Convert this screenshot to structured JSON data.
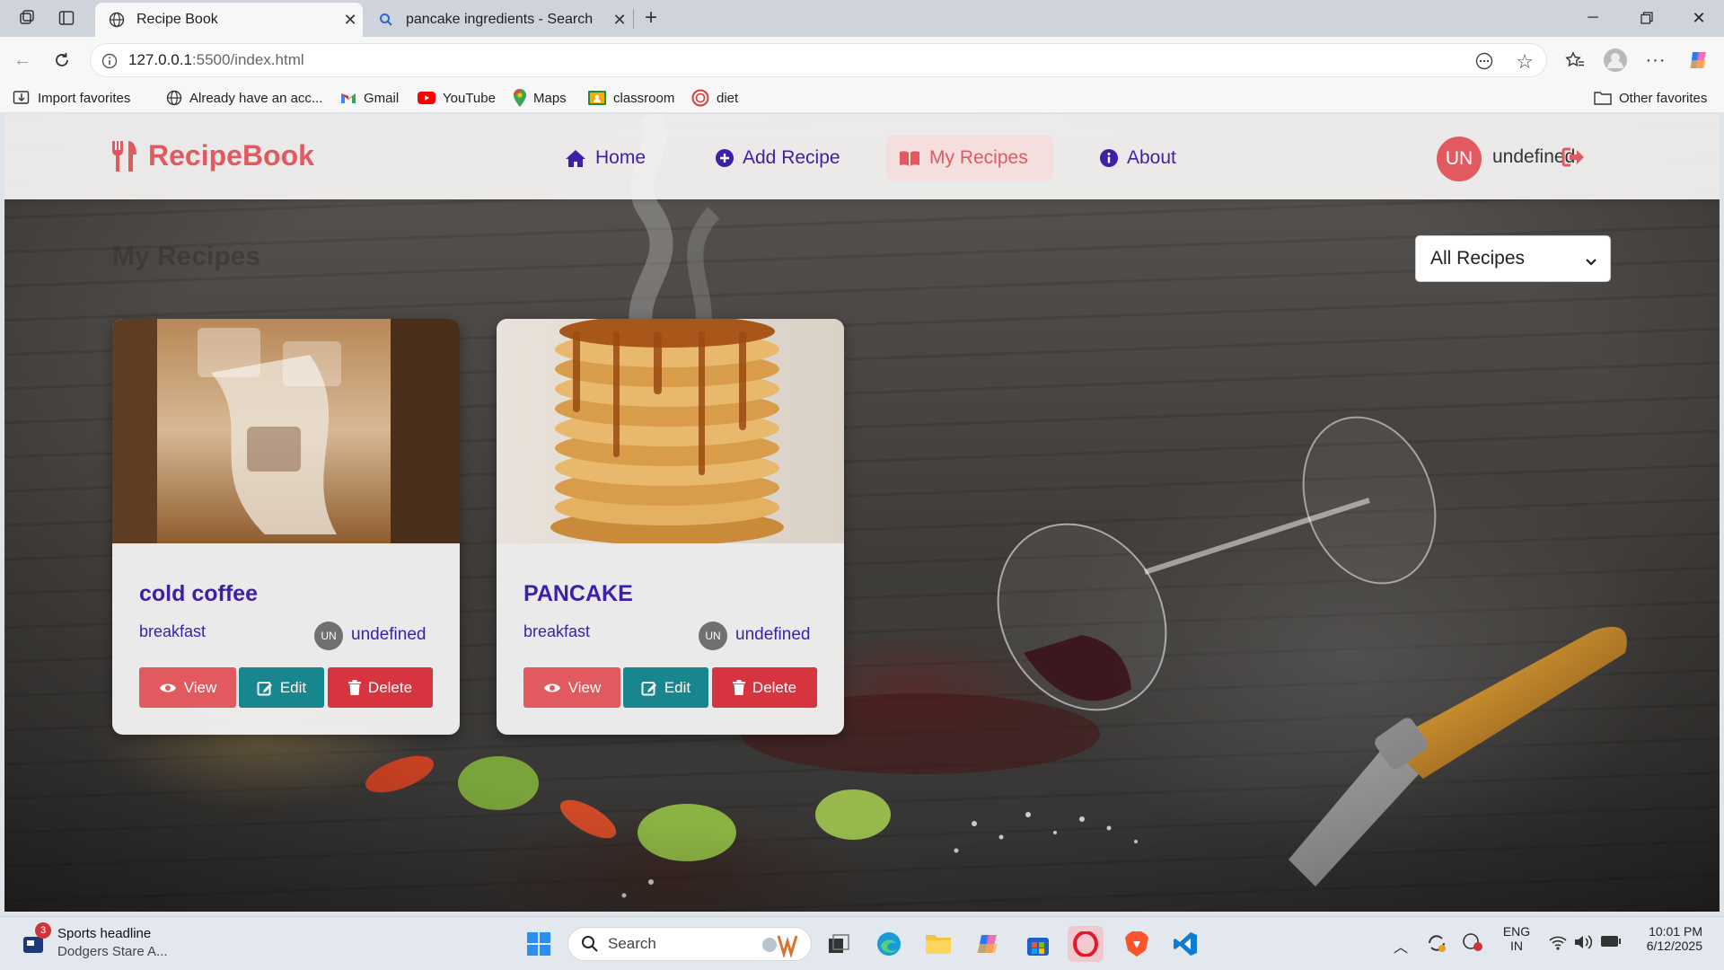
{
  "browser": {
    "tabs": [
      {
        "label": "Recipe Book",
        "active": true,
        "icon": "globe-icon"
      },
      {
        "label": "pancake ingredients - Search",
        "active": false,
        "icon": "search-icon"
      }
    ],
    "url": {
      "host": "127.0.0.1",
      "rest": ":5500/index.html"
    },
    "bookmarks": [
      {
        "label": "Import favorites",
        "icon": "import-icon"
      },
      {
        "label": "Already have an acc...",
        "icon": "globe-icon"
      },
      {
        "label": "Gmail",
        "icon": "gmail-icon"
      },
      {
        "label": "YouTube",
        "icon": "youtube-icon"
      },
      {
        "label": "Maps",
        "icon": "maps-icon"
      },
      {
        "label": "classroom",
        "icon": "classroom-icon"
      },
      {
        "label": "diet",
        "icon": "diet-icon"
      }
    ],
    "other_favorites": "Other favorites"
  },
  "app": {
    "brand": "RecipeBook",
    "nav": [
      {
        "label": "Home",
        "icon": "home-icon",
        "active": false
      },
      {
        "label": "Add Recipe",
        "icon": "plus-circle-icon",
        "active": false
      },
      {
        "label": "My Recipes",
        "icon": "book-open-icon",
        "active": true
      },
      {
        "label": "About",
        "icon": "info-circle-icon",
        "active": false
      }
    ],
    "user": {
      "initials": "UN",
      "name": "undefined"
    },
    "page_title": "My Recipes",
    "filter": {
      "selected": "All Recipes"
    },
    "recipes": [
      {
        "title": "cold coffee",
        "category": "breakfast",
        "author_initials": "UN",
        "author": "undefined"
      },
      {
        "title": "PANCAKE",
        "category": "breakfast",
        "author_initials": "UN",
        "author": "undefined"
      }
    ],
    "buttons": {
      "view": "View",
      "edit": "Edit",
      "delete": "Delete"
    }
  },
  "colors": {
    "brand": "#e05a5f",
    "nav_text": "#3d1fa8",
    "edit": "#17868f",
    "delete": "#d6343f"
  },
  "taskbar": {
    "news": {
      "badge": "3",
      "title": "Sports headline",
      "subtitle": "Dodgers Stare A..."
    },
    "search_placeholder": "Search",
    "lang": {
      "line1": "ENG",
      "line2": "IN"
    },
    "time": "10:01 PM",
    "date": "6/12/2025"
  }
}
